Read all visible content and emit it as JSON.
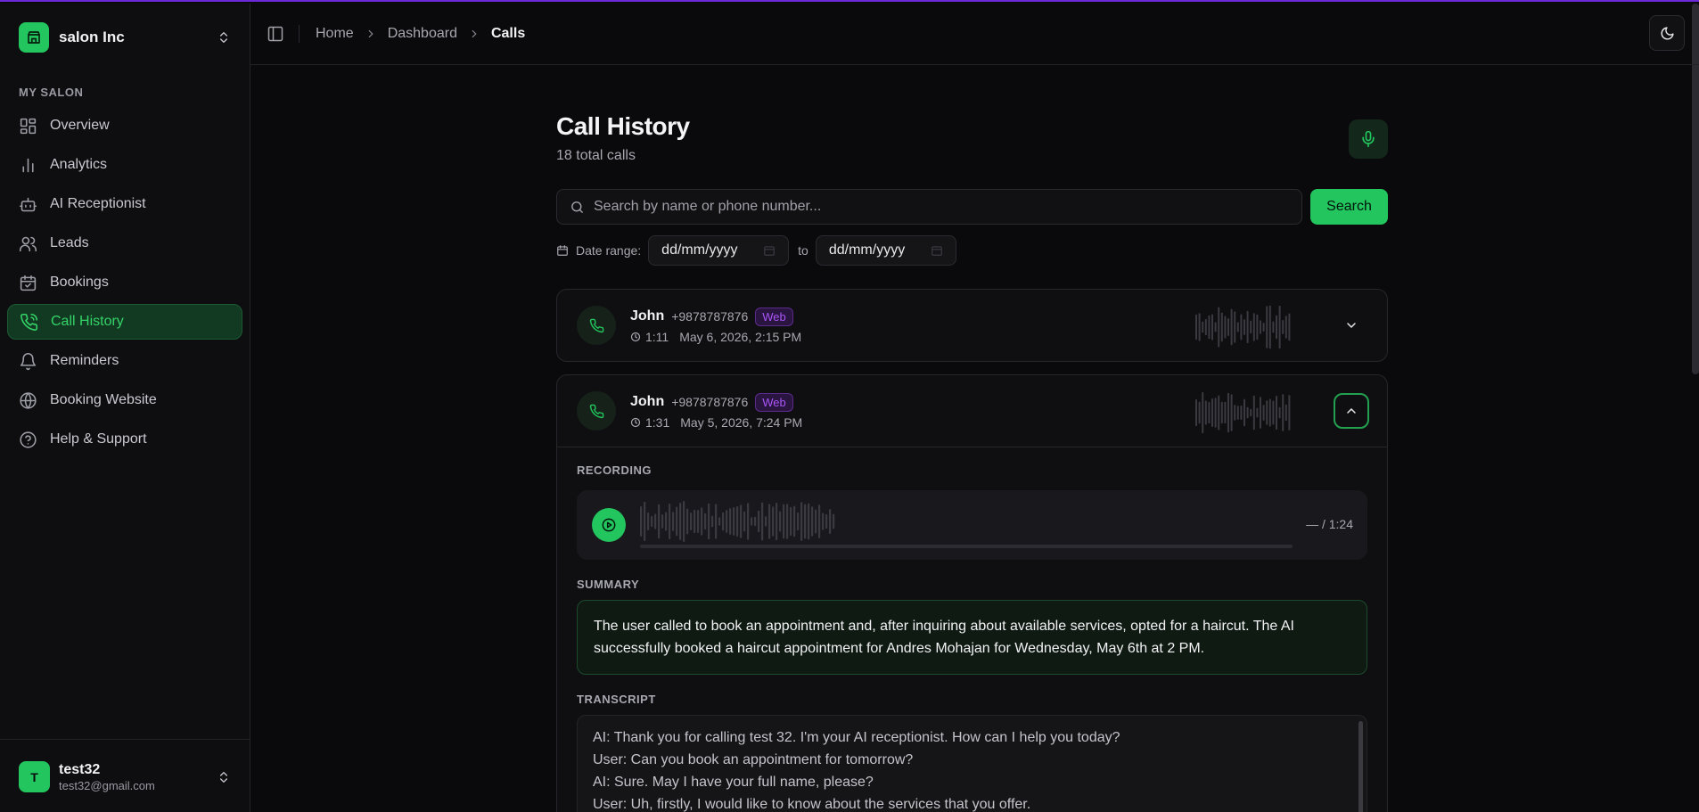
{
  "org": {
    "name": "salon Inc"
  },
  "sidebar": {
    "section_label": "MY SALON",
    "items": [
      {
        "label": "Overview",
        "icon": "grid-icon",
        "active": false
      },
      {
        "label": "Analytics",
        "icon": "bar-chart-icon",
        "active": false
      },
      {
        "label": "AI Receptionist",
        "icon": "bot-icon",
        "active": false
      },
      {
        "label": "Leads",
        "icon": "users-icon",
        "active": false
      },
      {
        "label": "Bookings",
        "icon": "calendar-check-icon",
        "active": false
      },
      {
        "label": "Call History",
        "icon": "phone-icon",
        "active": true
      },
      {
        "label": "Reminders",
        "icon": "bell-icon",
        "active": false
      },
      {
        "label": "Booking Website",
        "icon": "globe-icon",
        "active": false
      },
      {
        "label": "Help & Support",
        "icon": "help-circle-icon",
        "active": false
      }
    ]
  },
  "user": {
    "initial": "T",
    "name": "test32",
    "email": "test32@gmail.com"
  },
  "breadcrumb": [
    "Home",
    "Dashboard",
    "Calls"
  ],
  "page": {
    "title": "Call History",
    "subtitle": "18 total calls"
  },
  "search": {
    "placeholder": "Search by name or phone number...",
    "button": "Search"
  },
  "date_filter": {
    "label": "Date range:",
    "from": "dd/mm/yyyy",
    "to_label": "to",
    "to": "dd/mm/yyyy"
  },
  "calls": [
    {
      "name": "John",
      "phone": "+9878787876",
      "badge": "Web",
      "duration": "1:11",
      "date": "May 6, 2026, 2:15 PM",
      "expanded": false
    },
    {
      "name": "John",
      "phone": "+9878787876",
      "badge": "Web",
      "duration": "1:31",
      "date": "May 5, 2026, 7:24 PM",
      "expanded": true
    }
  ],
  "detail": {
    "recording_label": "RECORDING",
    "time": "— / 1:24",
    "progress": 0,
    "summary_label": "SUMMARY",
    "summary": "The user called to book an appointment and, after inquiring about available services, opted for a haircut. The AI successfully booked a haircut appointment for Andres Mohajan for Wednesday, May 6th at 2 PM.",
    "transcript_label": "TRANSCRIPT",
    "transcript": [
      "AI: Thank you for calling test 32. I'm your AI receptionist. How can I help you today?",
      "User: Can you book an appointment for tomorrow?",
      "AI: Sure. May I have your full name, please?",
      "User: Uh, firstly, I would like to know about the services that you offer."
    ]
  },
  "colors": {
    "accent": "#22c55e",
    "badge": "#a855f7",
    "border_top": "#6d28d9"
  }
}
